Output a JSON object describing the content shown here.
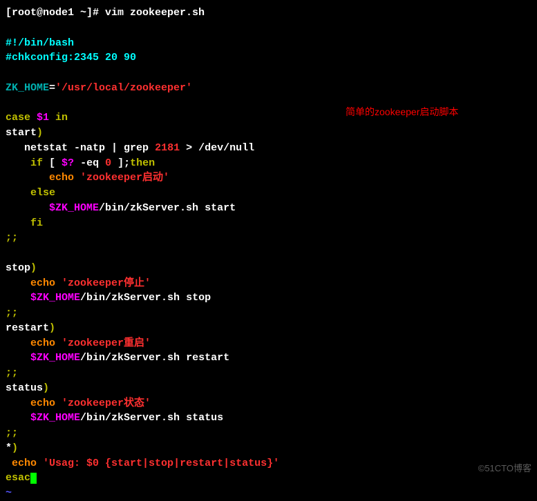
{
  "prompt_line": {
    "prompt": "[root@node1 ~]# ",
    "command": "vim zookeeper.sh"
  },
  "annotation": "简单的zookeeper启动脚本",
  "watermark": "©51CTO博客",
  "script": {
    "shebang": "#!/bin/bash",
    "chkconfig": "#chkconfig:2345 20 90",
    "var_name": "ZK_HOME",
    "eq": "=",
    "var_value": "'/usr/local/zookeeper'",
    "case_kw": "case",
    "dollar1": " $1 ",
    "in_kw": "in",
    "start_label": "start",
    "paren": ")",
    "netstat_indent": "   ",
    "netstat_cmd": "netstat ",
    "netstat_flags": "-natp",
    "netstat_pipe": " | grep ",
    "netstat_port": "2181",
    "netstat_redir": " > /dev/null",
    "if_indent": "    ",
    "if_kw": "if",
    "if_bracket_open": " [ ",
    "if_var": "$?",
    "if_eq": " -eq ",
    "if_zero": "0",
    "if_bracket_close": " ];",
    "then_kw": "then",
    "echo_indent": "       ",
    "echo_kw": "echo",
    "echo_start_msg": " 'zookeeper启动'",
    "else_indent": "    ",
    "else_kw": "else",
    "zkhome_indent": "       ",
    "zkhome_var": "$ZK_HOME",
    "zkhome_path": "/bin/zkServer.sh ",
    "zkhome_action_start": "start",
    "fi_indent": "    ",
    "fi_kw": "fi",
    "dsemicolon": ";;",
    "stop_label": "stop",
    "echo_indent2": "    ",
    "echo_stop_msg": " 'zookeeper停止'",
    "zkhome_indent2": "    ",
    "zkhome_action_stop": "stop",
    "restart_label": "restart",
    "echo_restart_msg": " 'zookeeper重启'",
    "zkhome_action_restart": "restart",
    "status_label": "status",
    "echo_status_msg": " 'zookeeper状态'",
    "zkhome_action_status": "status",
    "star": "*",
    "echo_usage_indent": " ",
    "echo_usage_msg": " 'Usag: $0 {start|stop|restart|status}'",
    "esac_kw": "esac",
    "tilde": "~"
  }
}
